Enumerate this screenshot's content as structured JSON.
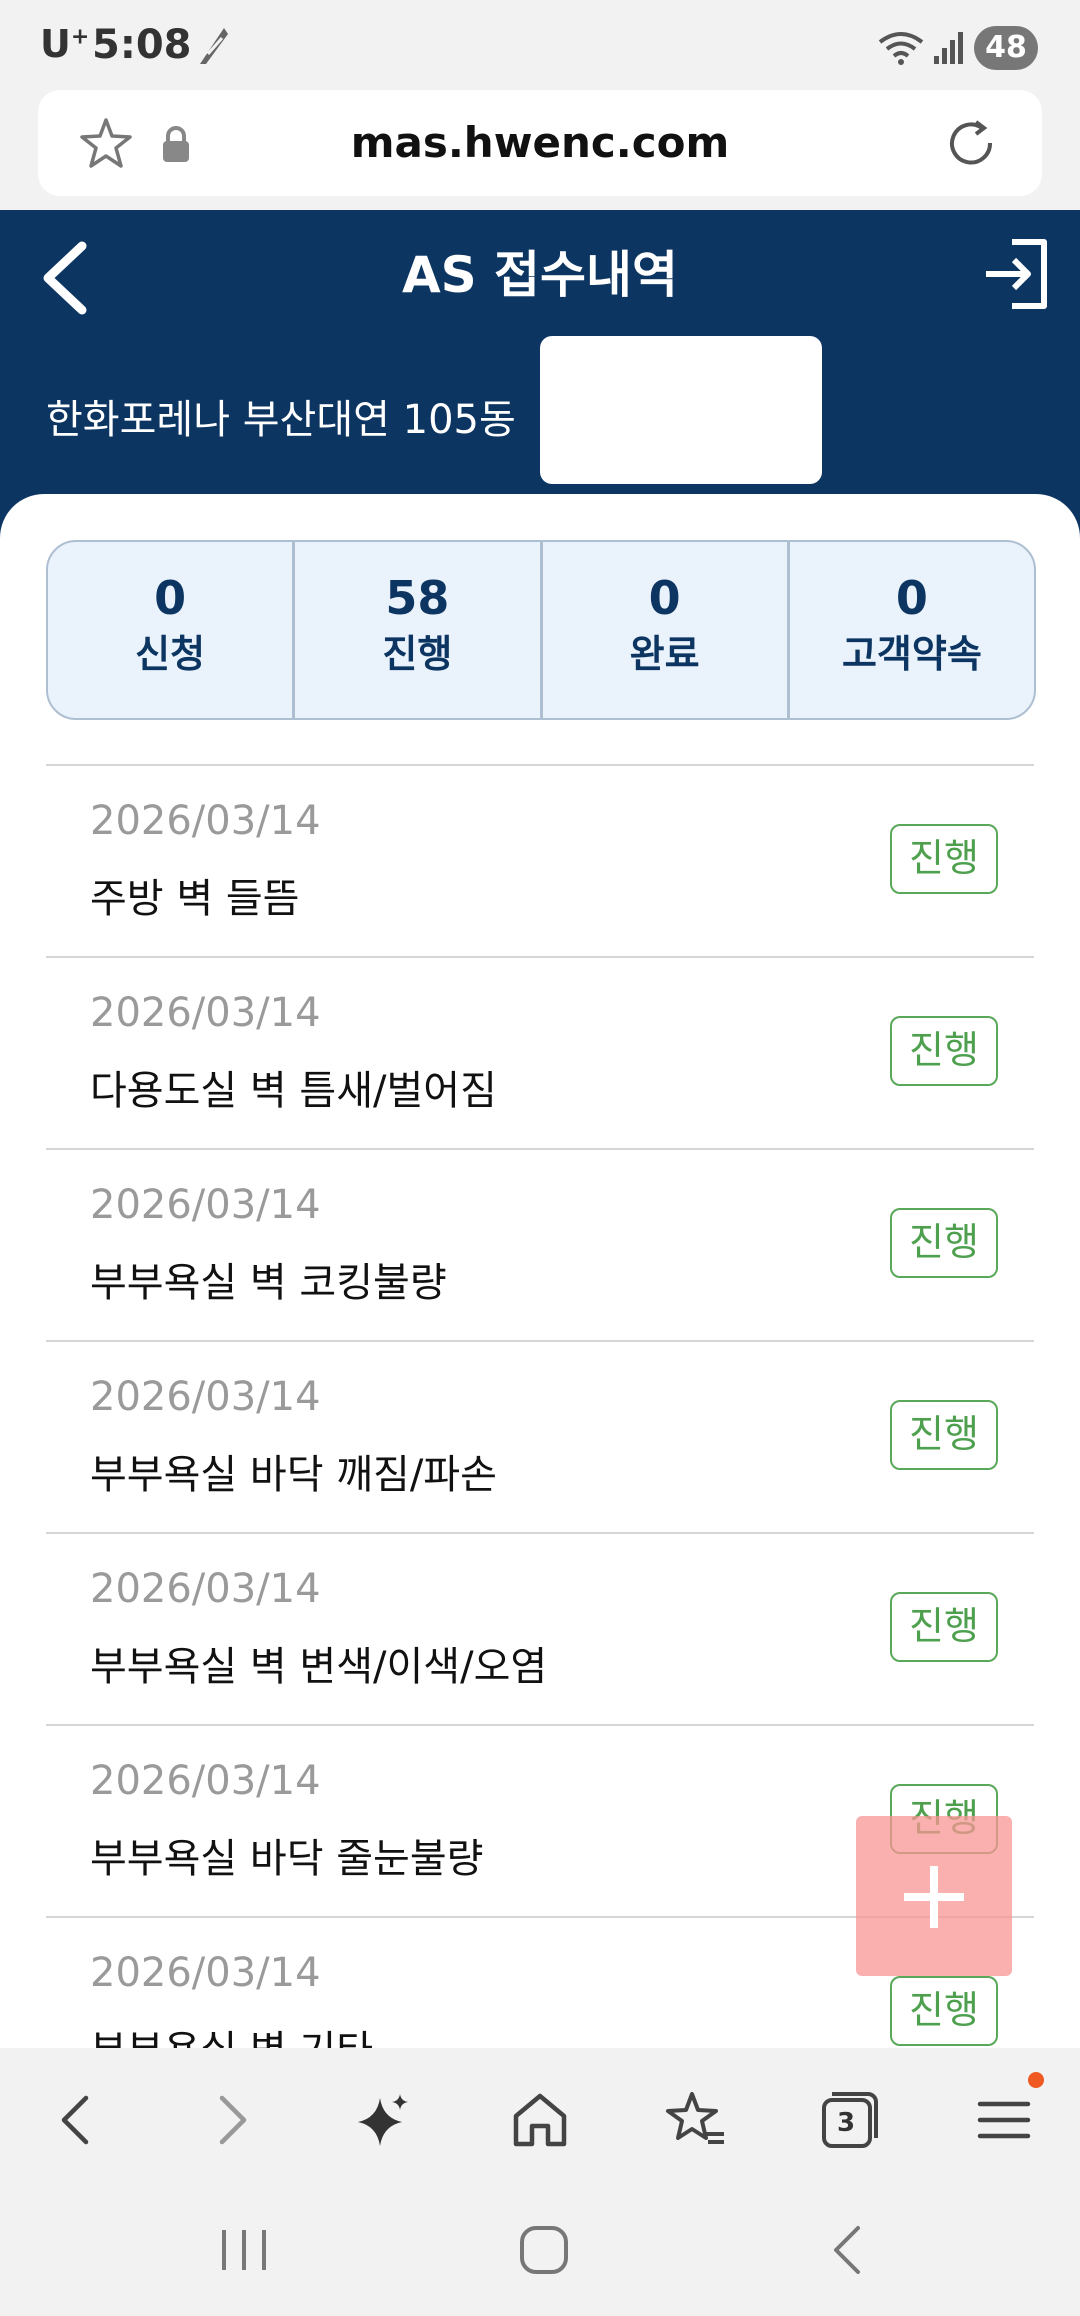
{
  "status_bar": {
    "carrier": "U",
    "carrier_sup": "+",
    "time": "5:08",
    "battery": "48"
  },
  "browser": {
    "url": "mas.hwenc.com",
    "tabs_count": "3"
  },
  "header": {
    "title": "AS 접수내역",
    "site": "한화포레나 부산대연 105동"
  },
  "stats": [
    {
      "count": "0",
      "label": "신청"
    },
    {
      "count": "58",
      "label": "진행"
    },
    {
      "count": "0",
      "label": "완료"
    },
    {
      "count": "0",
      "label": "고객약속"
    }
  ],
  "items": [
    {
      "date": "2026/03/14",
      "title": "주방 벽 들뜸",
      "status": "진행"
    },
    {
      "date": "2026/03/14",
      "title": "다용도실 벽 틈새/벌어짐",
      "status": "진행"
    },
    {
      "date": "2026/03/14",
      "title": "부부욕실 벽 코킹불량",
      "status": "진행"
    },
    {
      "date": "2026/03/14",
      "title": "부부욕실 바닥 깨짐/파손",
      "status": "진행"
    },
    {
      "date": "2026/03/14",
      "title": "부부욕실 벽 변색/이색/오염",
      "status": "진행"
    },
    {
      "date": "2026/03/14",
      "title": "부부욕실 바닥 줄눈불량",
      "status": "진행"
    },
    {
      "date": "2026/03/14",
      "title": "부부욕실 벽 기타",
      "status": "진행"
    }
  ],
  "colors": {
    "header_bg": "#0c3562",
    "status_green": "#4ea04e",
    "fab": "#f79696",
    "notification_dot": "#f05a22"
  },
  "icons": {
    "status_app": "feather-icon",
    "url_bookmark": "star-icon",
    "url_lock": "lock-icon",
    "url_reload": "reload-icon",
    "header_back": "chevron-left-icon",
    "header_logout": "logout-icon",
    "fab": "plus-icon",
    "toolbar": [
      "back-icon",
      "forward-icon",
      "sparkle-icon",
      "home-icon",
      "bookmarks-icon",
      "tabs-icon",
      "menu-icon"
    ]
  }
}
